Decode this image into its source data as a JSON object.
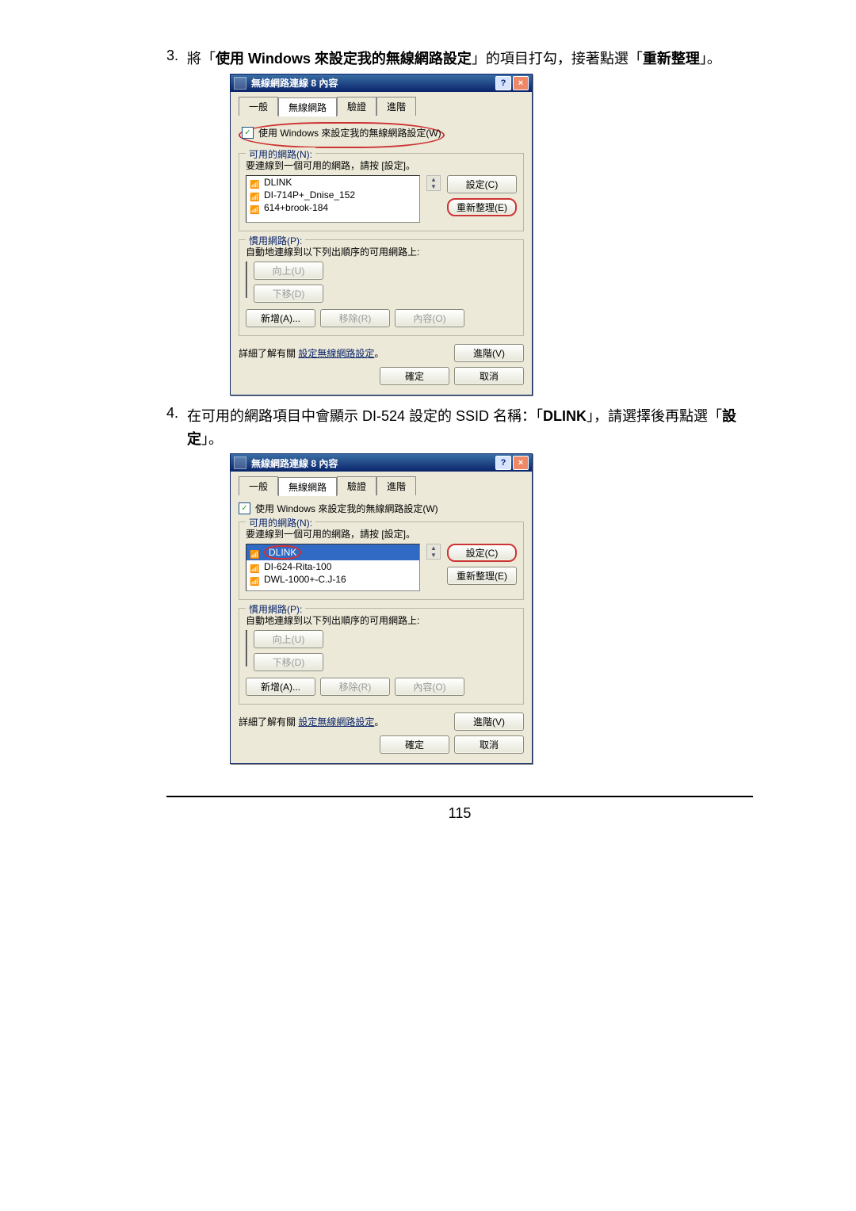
{
  "steps": {
    "s3": {
      "num": "3.",
      "pre": "將「",
      "bold": "使用 Windows 來設定我的無線網路設定",
      "mid": "」的項目打勾，接著點選「",
      "bold2": "重新整理",
      "post": "」。"
    },
    "s4": {
      "num": "4.",
      "pre": "在可用的網路項目中會顯示 DI-524 設定的 SSID 名稱：「",
      "bold": "DLINK",
      "mid": "」，請選擇後再點選「",
      "bold2": "設定",
      "post": "」。"
    }
  },
  "dlg": {
    "title": "無線網路連線 8 內容",
    "help": "?",
    "close": "×",
    "tabs": {
      "general": "一般",
      "wireless": "無線網路",
      "auth": "驗證",
      "adv": "進階"
    },
    "useWindows": "使用 Windows 來設定我的無線網路設定(W)",
    "grpAvail": {
      "title": "可用的網路(N):",
      "hint": "要連線到一個可用的網路，請按 [設定]。"
    },
    "grpPref": {
      "title": "慣用網路(P):",
      "hint": "自動地連線到以下列出順序的可用網路上:"
    },
    "btn": {
      "config": "設定(C)",
      "refresh": "重新整理(E)",
      "up": "向上(U)",
      "down": "下移(D)",
      "add": "新增(A)...",
      "remove": "移除(R)",
      "prop": "內容(O)",
      "advanced": "進階(V)",
      "ok": "確定",
      "cancel": "取消"
    },
    "learn1": "詳細了解有關 ",
    "learnLink": "設定無線網路設定",
    "learn2": "。"
  },
  "nets1": {
    "a": "DLINK",
    "b": "DI-714P+_Dnise_152",
    "c": "614+brook-184"
  },
  "nets2": {
    "a": "DLINK",
    "b": "DI-624-Rita-100",
    "c": "DWL-1000+-C.J-16"
  },
  "page_number": "115"
}
